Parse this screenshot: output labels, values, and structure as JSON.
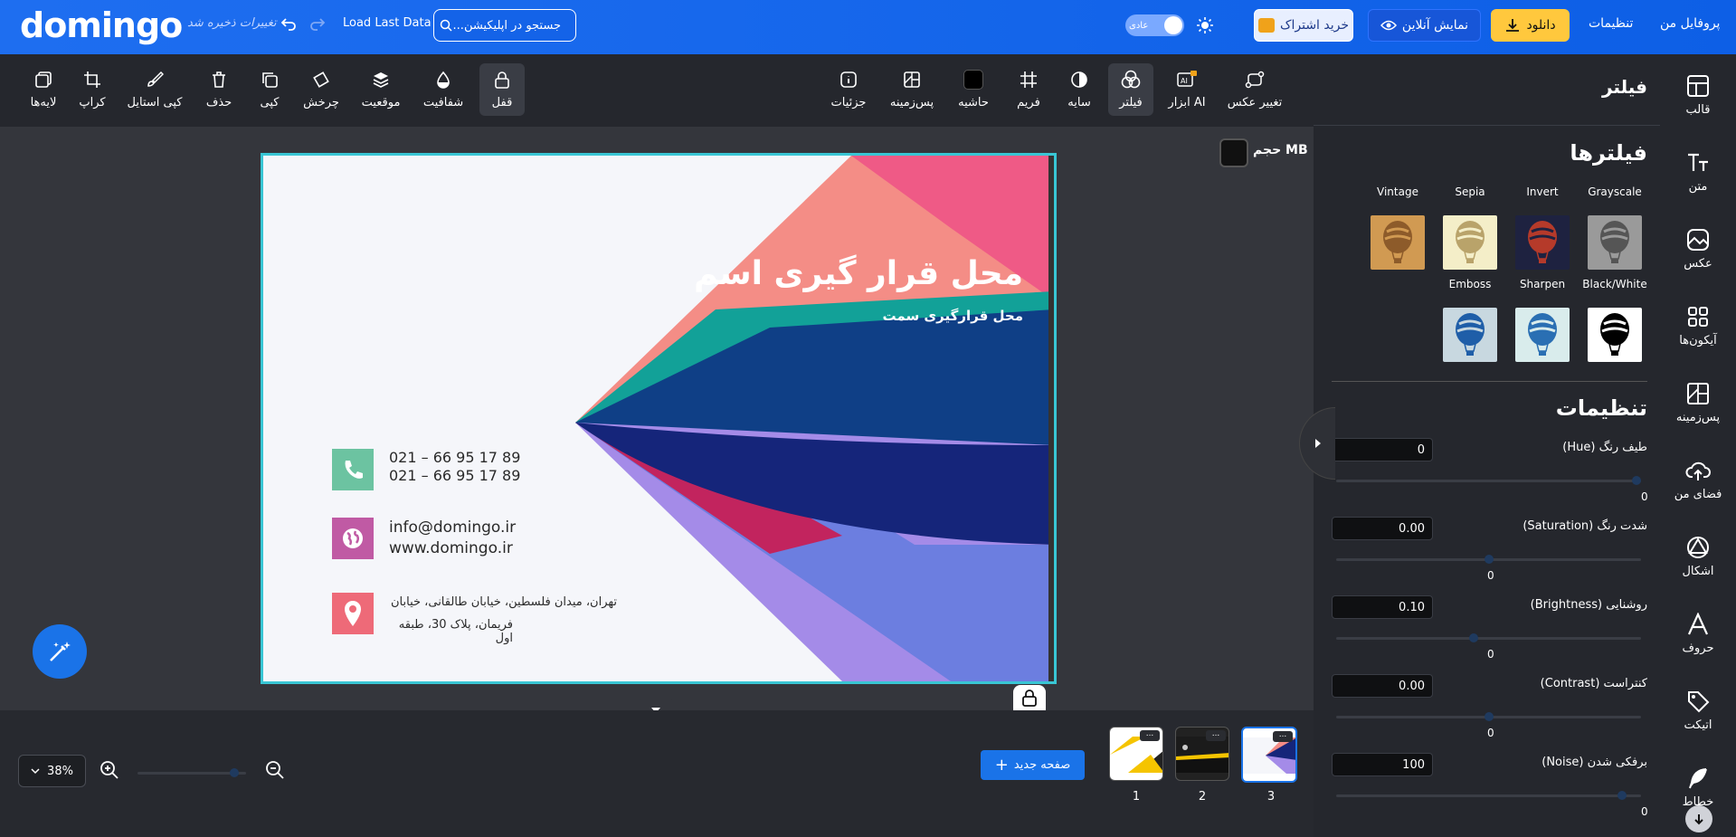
{
  "header": {
    "logo": "domingo",
    "saved_status": "تغییرات ذخیره شد",
    "load_last": "Load Last Data",
    "search_placeholder": "جستجو در اپلیکیشن...",
    "mode_label": "عادی",
    "buy_label": "خرید اشتراک",
    "preview_label": "نمایش آنلاین",
    "download_label": "دانلود",
    "settings_label": "تنظیمات",
    "profile_label": "پروفایل من"
  },
  "toolbar": {
    "left_tools": [
      {
        "label": "لایه‌ها",
        "icon": "layers-icon"
      },
      {
        "label": "کراپ",
        "icon": "crop-icon"
      },
      {
        "label": "کپی استایل",
        "icon": "brush-icon"
      },
      {
        "label": "حذف",
        "icon": "trash-icon"
      },
      {
        "label": "کپی",
        "icon": "copy-icon"
      },
      {
        "label": "چرخش",
        "icon": "rotate-icon"
      },
      {
        "label": "موقعیت",
        "icon": "stack-icon"
      },
      {
        "label": "شفافیت",
        "icon": "opacity-icon"
      },
      {
        "label": "قفل",
        "icon": "lock-icon"
      }
    ],
    "right_tools": [
      {
        "label": "جزئیات",
        "icon": "info-icon"
      },
      {
        "label": "پس‌زمینه",
        "icon": "background-icon"
      },
      {
        "label": "حاشیه",
        "icon": "border-icon"
      },
      {
        "label": "فریم",
        "icon": "frame-icon"
      },
      {
        "label": "سایه",
        "icon": "shadow-icon"
      },
      {
        "label": "فیلتر",
        "icon": "filter-icon"
      },
      {
        "label": "ابزار AI",
        "icon": "ai-tool-icon"
      },
      {
        "label": "تغییر عکس",
        "icon": "change-photo-icon"
      }
    ]
  },
  "canvas": {
    "size_label": "حجم MB",
    "card": {
      "title": "محل قرار گیری اسم",
      "subtitle": "محل قرارگیری سمت",
      "phone1": "021 – 66 95 17 89",
      "phone2": "021 – 66 95 17 89",
      "email": "info@domingo.ir",
      "website": "www.domingo.ir",
      "address1": "تهران، میدان فلسطین، خیابان طالقانی، خیابان",
      "address2": "فریمان، پلاک 30، طبقه اول"
    }
  },
  "bottom": {
    "zoom": "38%",
    "new_page": "صفحه جدید",
    "pages": [
      "1",
      "2",
      "3"
    ]
  },
  "panel": {
    "title": "فیلتر",
    "filters_heading": "فیلترها",
    "filters": [
      "Grayscale",
      "Invert",
      "Sepia",
      "Vintage",
      "Black/White",
      "Sharpen",
      "Emboss"
    ],
    "settings_heading": "تنظیمات",
    "settings": [
      {
        "label": "طیف رنگ (Hue)",
        "value": "0",
        "slider": "0",
        "level": 1.0
      },
      {
        "label": "شدت رنگ (Saturation)",
        "value": "0.00",
        "slider": "0",
        "level": 0.5
      },
      {
        "label": "روشنایی (Brightness)",
        "value": "0.10",
        "slider": "0",
        "level": 0.45
      },
      {
        "label": "کنتراست (Contrast)",
        "value": "0.00",
        "slider": "0",
        "level": 0.5
      },
      {
        "label": "برفکی شدن (Noise)",
        "value": "100",
        "slider": "0",
        "level": 0.95
      }
    ]
  },
  "sidebar": {
    "items": [
      {
        "label": "قالب",
        "icon": "template-icon"
      },
      {
        "label": "متن",
        "icon": "text-icon"
      },
      {
        "label": "عکس",
        "icon": "image-icon"
      },
      {
        "label": "آیکون‌ها",
        "icon": "icons-grid-icon"
      },
      {
        "label": "پس‌زمینه",
        "icon": "background-icon"
      },
      {
        "label": "فضای من",
        "icon": "cloud-upload-icon"
      },
      {
        "label": "اشکال",
        "icon": "shapes-icon"
      },
      {
        "label": "حروف",
        "icon": "letters-icon"
      },
      {
        "label": "اتیکت",
        "icon": "tag-icon"
      },
      {
        "label": "خطاط",
        "icon": "feather-icon"
      }
    ]
  }
}
